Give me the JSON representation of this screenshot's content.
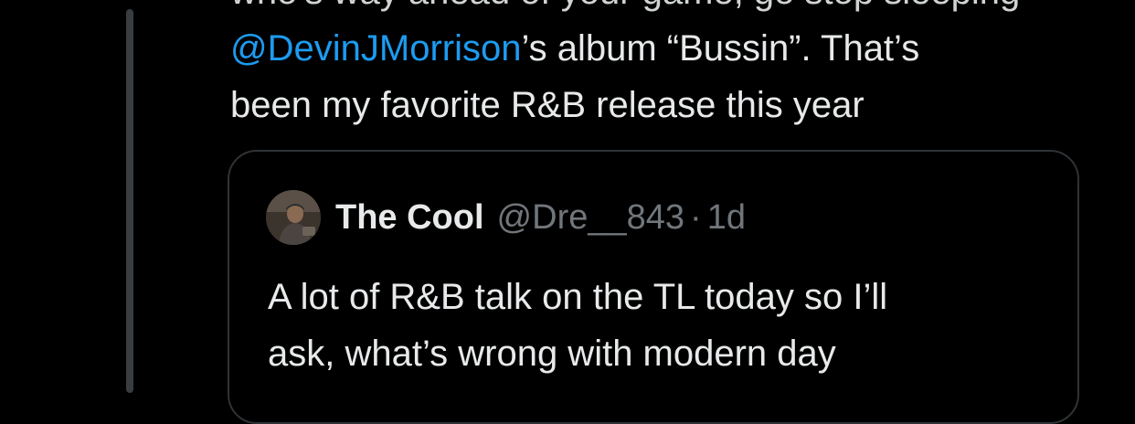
{
  "tweet": {
    "line_cut": "who’s way ahead of your game; go stop sleeping",
    "mention": "@DevinJMorrison",
    "line2_rest": "’s album “Bussin”.  That’s",
    "line3": "been my favorite R&B release this year"
  },
  "quote": {
    "display_name": "The Cool",
    "handle": "@Dre__843",
    "separator": "·",
    "time": "1d",
    "lines": [
      "A lot of R&B talk on the TL today so I’ll",
      "ask, what’s wrong with modern day"
    ]
  },
  "colors": {
    "background": "#000000",
    "text": "#e7e9ea",
    "mention": "#1d9bf0",
    "secondary": "#71767b",
    "border": "#2f3336",
    "thread_line": "#3a3d40"
  },
  "icons": {
    "avatar": "user-avatar-photo"
  }
}
